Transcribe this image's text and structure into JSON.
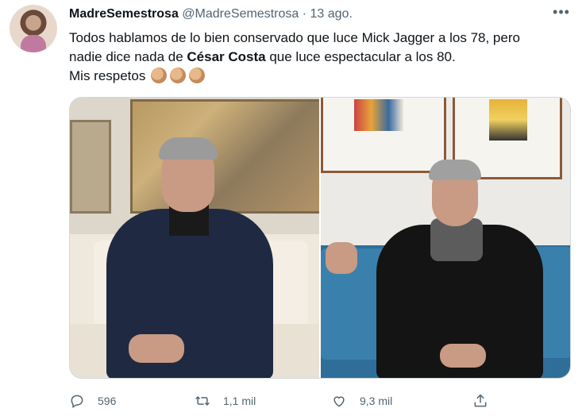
{
  "tweet": {
    "author_name": "MadreSemestrosa",
    "author_handle": "@MadreSemestrosa",
    "separator": "·",
    "timestamp": "13 ago.",
    "more_icon": "more-horizontal-icon",
    "text": {
      "line1": "Todos hablamos de lo bien conservado que luce Mick Jagger a los 78, pero",
      "line2_part1": "nadie dice nada de ",
      "line2_bold": "César Costa",
      "line2_part2": " que luce espectacular a los 80.",
      "line3": "Mis respetos",
      "emoji": "👏🏽👏🏽👏🏽"
    },
    "actions": {
      "reply_count": "596",
      "retweet_count": "1,1 mil",
      "like_count": "9,3 mil"
    }
  },
  "colors": {
    "text_primary": "#0f1419",
    "text_secondary": "#536471",
    "border": "#cfd9de"
  }
}
